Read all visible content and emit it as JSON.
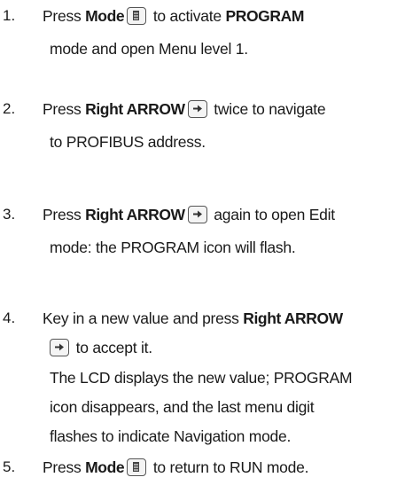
{
  "steps": [
    {
      "number": "1.",
      "lines": [
        {
          "parts": [
            "Press ",
            "Mode",
            " to activate ",
            "PROGRAM"
          ]
        },
        {
          "text": "mode and open Menu level 1."
        }
      ]
    },
    {
      "number": "2.",
      "lines": [
        {
          "parts": [
            "Press ",
            "Right ARROW",
            " twice to navigate"
          ]
        },
        {
          "text": "to PROFIBUS address."
        }
      ]
    },
    {
      "number": "3.",
      "lines": [
        {
          "parts": [
            "Press ",
            "Right ARROW",
            " again to open Edit"
          ]
        },
        {
          "text": "mode: the PROGRAM icon will flash."
        }
      ]
    },
    {
      "number": "4.",
      "lines": [
        {
          "parts": [
            "Key in a new value and press ",
            "Right ARROW"
          ]
        },
        {
          "text": " to accept it."
        },
        {
          "text": "The LCD displays the new value; PROGRAM"
        },
        {
          "text": "icon disappears, and the last menu digit"
        },
        {
          "text": "flashes to indicate Navigation mode."
        }
      ]
    },
    {
      "number": "5.",
      "lines": [
        {
          "parts": [
            "Press ",
            "Mode",
            " to return to RUN mode."
          ]
        }
      ]
    }
  ],
  "icons": {
    "mode_key": "mode-key-icon",
    "right_arrow_key": "right-arrow-key-icon"
  }
}
